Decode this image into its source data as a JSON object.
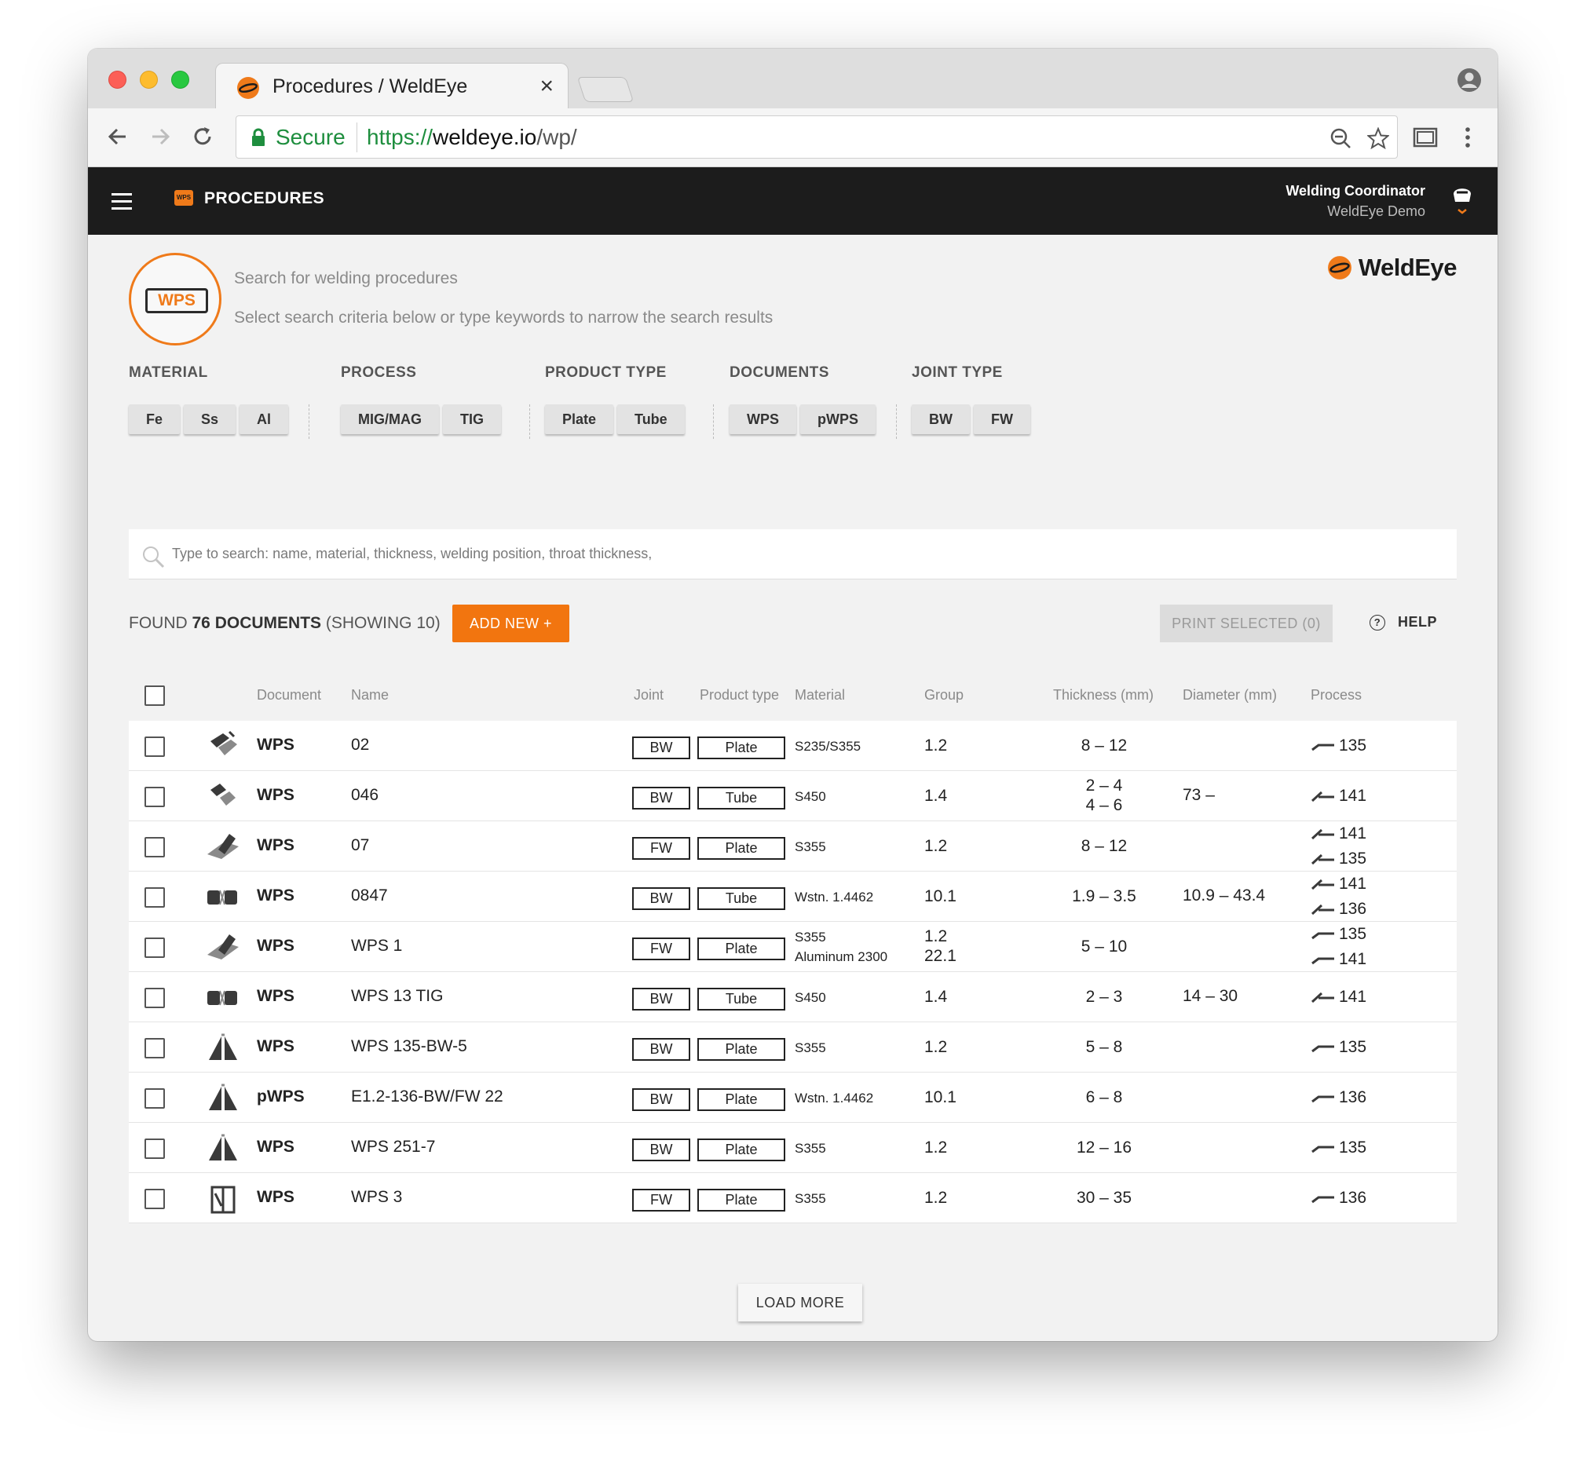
{
  "browser": {
    "tab_title": "Procedures / WeldEye",
    "close_glyph": "×",
    "secure_label": "Secure",
    "url_scheme": "https://",
    "url_host": "weldeye.io",
    "url_path": "/wp/"
  },
  "appbar": {
    "title": "PROCEDURES",
    "wps_mini_label": "WPS",
    "user_role": "Welding Coordinator",
    "user_org": "WeldEye Demo"
  },
  "search": {
    "badge_label": "WPS",
    "title": "Search for welding procedures",
    "subtitle": "Select search criteria below or type keywords to narrow the search results",
    "placeholder": "Type to search: name, material, thickness, welding position, throat thickness,",
    "brand": "WeldEye"
  },
  "filters": [
    {
      "label": "MATERIAL",
      "options": [
        "Fe",
        "Ss",
        "Al"
      ]
    },
    {
      "label": "PROCESS",
      "options": [
        "MIG/MAG",
        "TIG"
      ]
    },
    {
      "label": "PRODUCT TYPE",
      "options": [
        "Plate",
        "Tube"
      ]
    },
    {
      "label": "DOCUMENTS",
      "options": [
        "WPS",
        "pWPS"
      ]
    },
    {
      "label": "JOINT TYPE",
      "options": [
        "BW",
        "FW"
      ]
    }
  ],
  "results": {
    "found_prefix": "FOUND ",
    "found_count": "76 DOCUMENTS",
    "showing": " (SHOWING 10)",
    "add_new": "ADD NEW +",
    "print_selected": "PRINT SELECTED (0)",
    "help": "HELP",
    "help_icon_glyph": "?",
    "load_more": "LOAD MORE"
  },
  "columns": [
    "Document",
    "Name",
    "Joint",
    "Product type",
    "Material",
    "Group",
    "Thickness (mm)",
    "Diameter (mm)",
    "Process"
  ],
  "rows": [
    {
      "icon": "plate-bw-icon",
      "document": "WPS",
      "name": "02",
      "joint": "BW",
      "product": "Plate",
      "material": [
        "S235/S355"
      ],
      "group": [
        "1.2"
      ],
      "thickness": [
        "8 – 12"
      ],
      "diameter": "",
      "process": [
        {
          "code": "135",
          "icon": "mig-torch-icon"
        }
      ]
    },
    {
      "icon": "tube-bw-icon",
      "document": "WPS",
      "name": "046",
      "joint": "BW",
      "product": "Tube",
      "material": [
        "S450"
      ],
      "group": [
        "1.4"
      ],
      "thickness": [
        "2 – 4",
        "4 – 6"
      ],
      "diameter": "73 –",
      "process": [
        {
          "code": "141",
          "icon": "tig-torch-icon"
        }
      ]
    },
    {
      "icon": "plate-fw-icon",
      "document": "WPS",
      "name": "07",
      "joint": "FW",
      "product": "Plate",
      "material": [
        "S355"
      ],
      "group": [
        "1.2"
      ],
      "thickness": [
        "8 – 12"
      ],
      "diameter": "",
      "process": [
        {
          "code": "141",
          "icon": "tig-torch-icon"
        },
        {
          "code": "135",
          "icon": "tig-torch-icon"
        }
      ]
    },
    {
      "icon": "tube-joint-icon",
      "document": "WPS",
      "name": "0847",
      "joint": "BW",
      "product": "Tube",
      "material": [
        "Wstn. 1.4462"
      ],
      "group": [
        "10.1"
      ],
      "thickness": [
        "1.9 – 3.5"
      ],
      "diameter": "10.9 – 43.4",
      "process": [
        {
          "code": "141",
          "icon": "tig-torch-icon"
        },
        {
          "code": "136",
          "icon": "tig-torch-icon"
        }
      ]
    },
    {
      "icon": "plate-fw-icon",
      "document": "WPS",
      "name": "WPS 1",
      "joint": "FW",
      "product": "Plate",
      "material": [
        "S355",
        "Aluminum 2300"
      ],
      "group": [
        "1.2",
        "22.1"
      ],
      "thickness": [
        "5 – 10"
      ],
      "diameter": "",
      "process": [
        {
          "code": "135",
          "icon": "mig-torch-icon"
        },
        {
          "code": "141",
          "icon": "mig-torch-icon"
        }
      ]
    },
    {
      "icon": "tube-joint-icon",
      "document": "WPS",
      "name": "WPS 13 TIG",
      "joint": "BW",
      "product": "Tube",
      "material": [
        "S450"
      ],
      "group": [
        "1.4"
      ],
      "thickness": [
        "2 – 3"
      ],
      "diameter": "14 – 30",
      "process": [
        {
          "code": "141",
          "icon": "tig-torch-icon"
        }
      ]
    },
    {
      "icon": "plate-v-icon",
      "document": "WPS",
      "name": "WPS 135-BW-5",
      "joint": "BW",
      "product": "Plate",
      "material": [
        "S355"
      ],
      "group": [
        "1.2"
      ],
      "thickness": [
        "5 – 8"
      ],
      "diameter": "",
      "process": [
        {
          "code": "135",
          "icon": "mig-torch-icon"
        }
      ]
    },
    {
      "icon": "plate-v-icon",
      "document": "pWPS",
      "name": "E1.2-136-BW/FW 22",
      "joint": "BW",
      "product": "Plate",
      "material": [
        "Wstn. 1.4462"
      ],
      "group": [
        "10.1"
      ],
      "thickness": [
        "6 – 8"
      ],
      "diameter": "",
      "process": [
        {
          "code": "136",
          "icon": "mig-torch-icon"
        }
      ]
    },
    {
      "icon": "plate-v-icon",
      "document": "WPS",
      "name": "WPS 251-7",
      "joint": "BW",
      "product": "Plate",
      "material": [
        "S355"
      ],
      "group": [
        "1.2"
      ],
      "thickness": [
        "12 – 16"
      ],
      "diameter": "",
      "process": [
        {
          "code": "135",
          "icon": "mig-torch-icon"
        }
      ]
    },
    {
      "icon": "plate-vertical-icon",
      "document": "WPS",
      "name": "WPS 3",
      "joint": "FW",
      "product": "Plate",
      "material": [
        "S355"
      ],
      "group": [
        "1.2"
      ],
      "thickness": [
        "30 – 35"
      ],
      "diameter": "",
      "process": [
        {
          "code": "136",
          "icon": "mig-torch-icon"
        }
      ]
    }
  ],
  "colors": {
    "accent": "#f2750f",
    "appbar": "#1c1c1c",
    "secure": "#1e8e3e"
  }
}
